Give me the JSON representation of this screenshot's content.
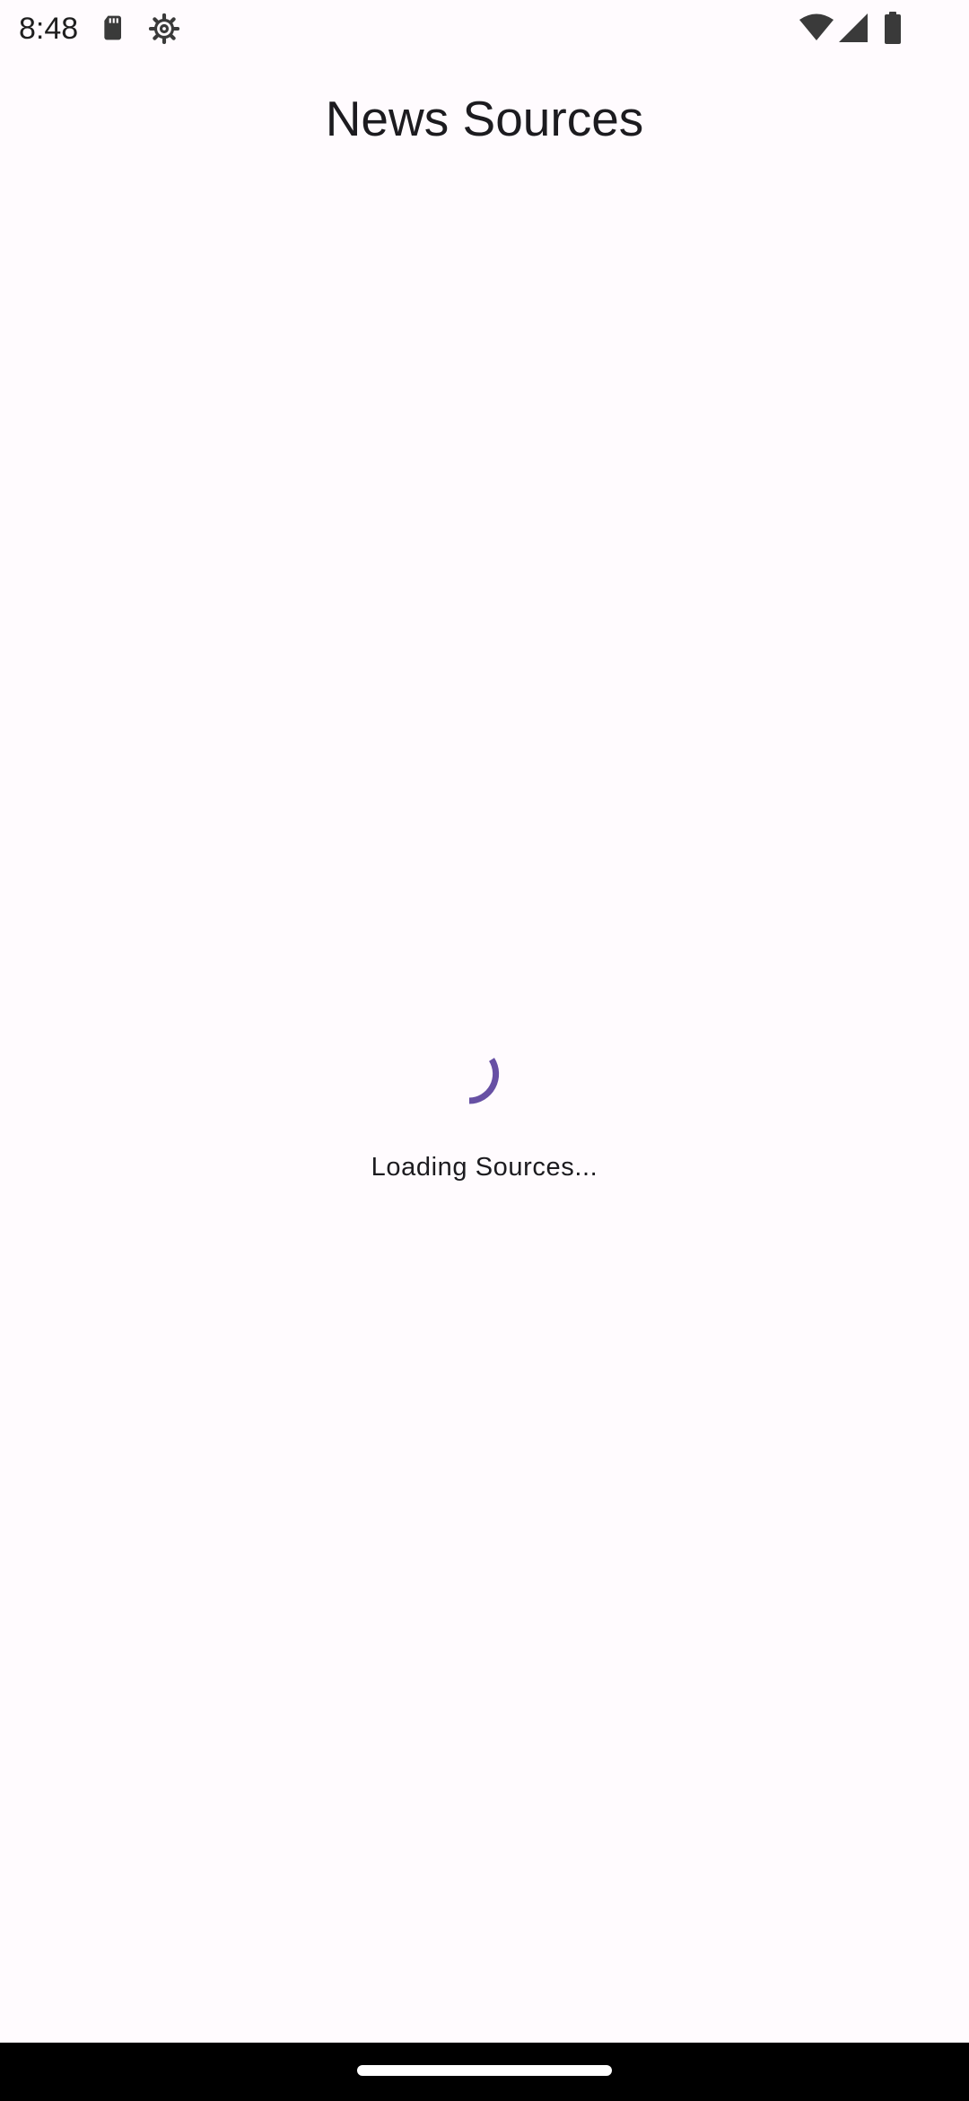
{
  "status_bar": {
    "time": "8:48",
    "icons": [
      "sd-card-icon",
      "settings-gear-icon",
      "wifi-icon",
      "cellular-signal-icon",
      "battery-icon"
    ]
  },
  "app_bar": {
    "title": "News Sources"
  },
  "loader": {
    "text": "Loading Sources...",
    "accent_color": "#6750a4"
  },
  "colors": {
    "background": "#fffbfe",
    "nav_bar": "#000000"
  }
}
